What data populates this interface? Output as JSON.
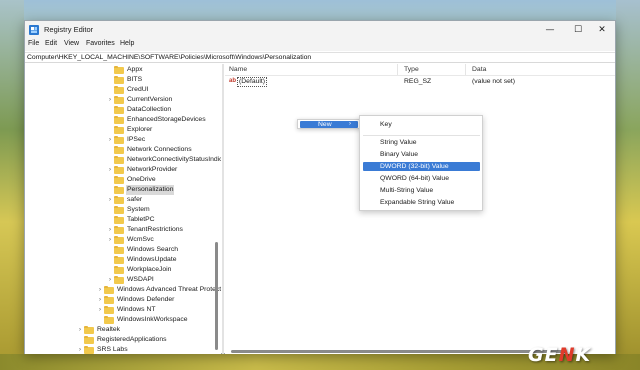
{
  "window": {
    "title": "Registry Editor",
    "controls": {
      "minimize": "—",
      "maximize": "☐",
      "close": "✕"
    }
  },
  "menu": [
    "File",
    "Edit",
    "View",
    "Favorites",
    "Help"
  ],
  "address": "Computer\\HKEY_LOCAL_MACHINE\\SOFTWARE\\Policies\\Microsoft\\Windows\\Personalization",
  "tree": [
    {
      "label": "Appx",
      "chevron": ""
    },
    {
      "label": "BITS",
      "chevron": ""
    },
    {
      "label": "CredUI",
      "chevron": ""
    },
    {
      "label": "CurrentVersion",
      "chevron": "›"
    },
    {
      "label": "DataCollection",
      "chevron": ""
    },
    {
      "label": "EnhancedStorageDevices",
      "chevron": ""
    },
    {
      "label": "Explorer",
      "chevron": ""
    },
    {
      "label": "IPSec",
      "chevron": "›"
    },
    {
      "label": "Network Connections",
      "chevron": ""
    },
    {
      "label": "NetworkConnectivityStatusIndicator",
      "chevron": ""
    },
    {
      "label": "NetworkProvider",
      "chevron": "›"
    },
    {
      "label": "OneDrive",
      "chevron": ""
    },
    {
      "label": "Personalization",
      "chevron": "",
      "selected": true
    },
    {
      "label": "safer",
      "chevron": "›"
    },
    {
      "label": "System",
      "chevron": ""
    },
    {
      "label": "TabletPC",
      "chevron": ""
    },
    {
      "label": "TenantRestrictions",
      "chevron": "›"
    },
    {
      "label": "WcmSvc",
      "chevron": "›"
    },
    {
      "label": "Windows Search",
      "chevron": ""
    },
    {
      "label": "WindowsUpdate",
      "chevron": ""
    },
    {
      "label": "WorkplaceJoin",
      "chevron": ""
    },
    {
      "label": "WSDAPI",
      "chevron": "›"
    },
    {
      "label": "Windows Advanced Threat Protection",
      "chevron": "›"
    },
    {
      "label": "Windows Defender",
      "chevron": "›"
    },
    {
      "label": "Windows NT",
      "chevron": "›"
    },
    {
      "label": "WindowsInkWorkspace",
      "chevron": ""
    },
    {
      "label": "Realtek",
      "chevron": "›"
    },
    {
      "label": "RegisteredApplications",
      "chevron": ""
    },
    {
      "label": "SRS Labs",
      "chevron": "›"
    }
  ],
  "columns": {
    "name": "Name",
    "type": "Type",
    "data": "Data"
  },
  "values": [
    {
      "icon": "ab",
      "name": "(Default)",
      "type": "REG_SZ",
      "data": "(value not set)"
    }
  ],
  "context_menu": {
    "new_label": "New",
    "new_arrow": "›"
  },
  "submenu": [
    "Key",
    "String Value",
    "Binary Value",
    "DWORD (32-bit) Value",
    "QWORD (64-bit) Value",
    "Multi-String Value",
    "Expandable String Value"
  ],
  "submenu_active": "DWORD (32-bit) Value",
  "watermark": {
    "prefix": "GE",
    "accent": "N",
    "suffix": "K"
  },
  "colors": {
    "accent": "#3a7bd5",
    "folder": "#f2c94c",
    "selection": "#d9d9d9"
  }
}
